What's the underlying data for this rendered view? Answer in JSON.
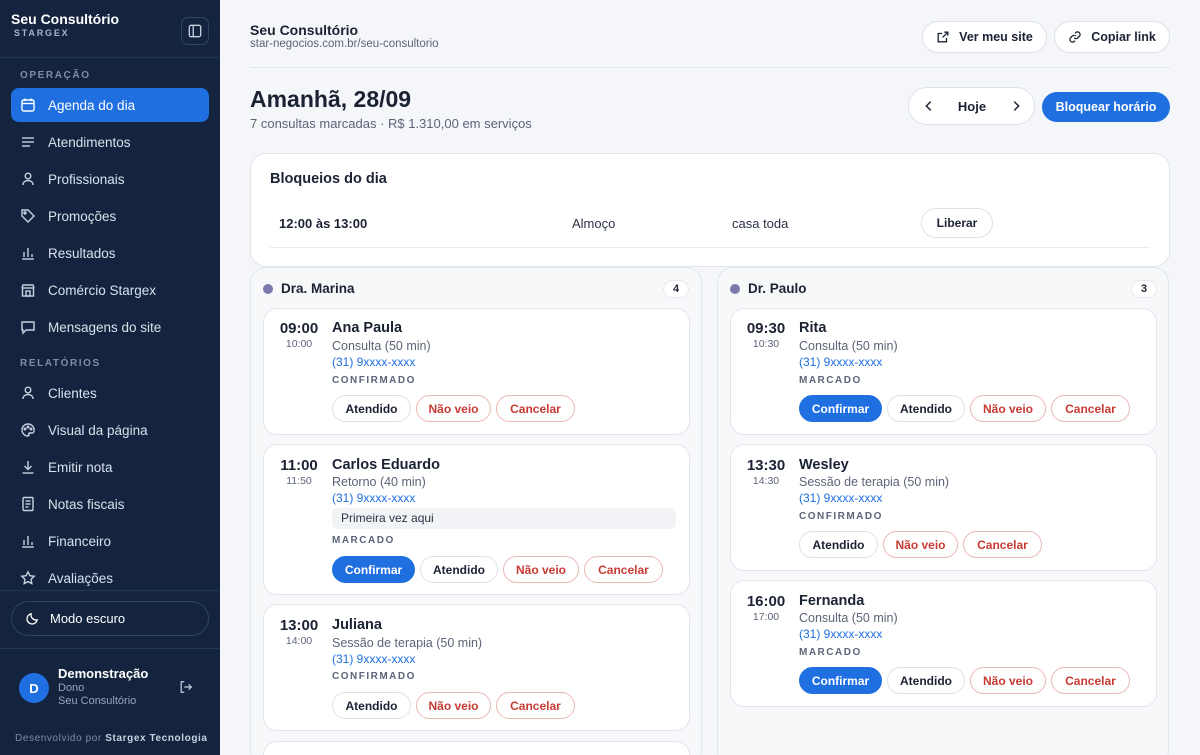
{
  "sidebar": {
    "brand_title": "Seu Consultório",
    "brand_sub": "STARGEX",
    "section_operacao": "OPERAÇÃO",
    "section_relatorios": "RELATÓRIOS",
    "items": [
      {
        "label": "Agenda do dia",
        "icon": "calendar-icon",
        "active": true
      },
      {
        "label": "Atendimentos",
        "icon": "list-icon"
      },
      {
        "label": "Profissionais",
        "icon": "user-icon"
      },
      {
        "label": "Promoções",
        "icon": "tag-icon"
      },
      {
        "label": "Resultados",
        "icon": "bar-chart-icon"
      },
      {
        "label": "Comércio Stargex",
        "icon": "store-icon"
      },
      {
        "label": "Mensagens do site",
        "icon": "message-icon"
      }
    ],
    "report_items": [
      {
        "label": "Clientes",
        "icon": "user-icon"
      },
      {
        "label": "Visual da página",
        "icon": "palette-icon"
      },
      {
        "label": "Emitir nota",
        "icon": "download-icon"
      },
      {
        "label": "Notas fiscais",
        "icon": "receipt-icon"
      },
      {
        "label": "Financeiro",
        "icon": "bar-chart-icon"
      },
      {
        "label": "Avaliações",
        "icon": "star-icon"
      }
    ],
    "dark_mode_label": "Modo escuro",
    "user": {
      "initial": "D",
      "name": "Demonstração",
      "role": "Dono",
      "org": "Seu Consultório"
    },
    "footer_prefix": "Desenvolvido por",
    "footer_company": "Stargex Tecnologia"
  },
  "header": {
    "title": "Seu Consultório",
    "url": "star-negocios.com.br/seu-consultorio",
    "view_site_label": "Ver meu site",
    "copy_link_label": "Copiar link"
  },
  "day": {
    "title": "Amanhã, 28/09",
    "subtitle": "7 consultas marcadas · R$ 1.310,00 em serviços",
    "today_label": "Hoje",
    "block_button_label": "Bloquear horário"
  },
  "blocks": {
    "title": "Bloqueios do dia",
    "items": [
      {
        "time": "12:00 às 13:00",
        "reason": "Almoço",
        "scope": "casa toda",
        "action": "Liberar"
      }
    ]
  },
  "actions": {
    "confirm": "Confirmar",
    "attended": "Atendido",
    "no_show": "Não veio",
    "cancel": "Cancelar"
  },
  "columns": [
    {
      "name": "Dra. Marina",
      "count": "4",
      "dot_color": "#7d79ad",
      "appointments": [
        {
          "start": "09:00",
          "end": "10:00",
          "client": "Ana Paula",
          "service": "Consulta (50 min)",
          "phone": "(31) 9xxxx-xxxx",
          "status": "CONFIRMADO"
        },
        {
          "start": "11:00",
          "end": "11:50",
          "client": "Carlos Eduardo",
          "service": "Retorno (40 min)",
          "phone": "(31) 9xxxx-xxxx",
          "note": "Primeira vez aqui",
          "status": "MARCADO"
        },
        {
          "start": "13:00",
          "end": "14:00",
          "client": "Juliana",
          "service": "Sessão de terapia (50 min)",
          "phone": "(31) 9xxxx-xxxx",
          "status": "CONFIRMADO"
        }
      ]
    },
    {
      "name": "Dr. Paulo",
      "count": "3",
      "dot_color": "#7d79ad",
      "appointments": [
        {
          "start": "09:30",
          "end": "10:30",
          "client": "Rita",
          "service": "Consulta (50 min)",
          "phone": "(31) 9xxxx-xxxx",
          "status": "MARCADO"
        },
        {
          "start": "13:30",
          "end": "14:30",
          "client": "Wesley",
          "service": "Sessão de terapia (50 min)",
          "phone": "(31) 9xxxx-xxxx",
          "status": "CONFIRMADO"
        },
        {
          "start": "16:00",
          "end": "17:00",
          "client": "Fernanda",
          "service": "Consulta (50 min)",
          "phone": "(31) 9xxxx-xxxx",
          "status": "MARCADO"
        }
      ]
    }
  ]
}
